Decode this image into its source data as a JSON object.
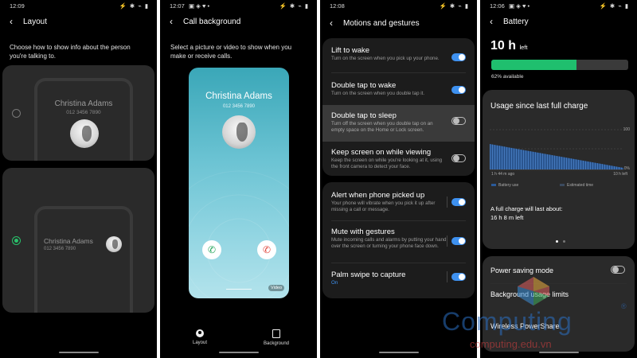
{
  "screen_layout": {
    "status_time": "12:09",
    "status_icons": "⚡ ✱ ⌁ ▮",
    "back": "‹",
    "title": "Layout",
    "description": "Choose how to show info about the person you're talking to.",
    "option1": {
      "name": "Christina Adams",
      "number": "012 3456 7890",
      "selected": false
    },
    "option2": {
      "name": "Christina Adams",
      "number": "012 3456 7890",
      "selected": true
    }
  },
  "screen_background": {
    "status_time": "12:07",
    "status_extra": "▣ ◈ ♥ •",
    "status_icons": "⚡ ✱ ⌁ ▮",
    "back": "‹",
    "title": "Call background",
    "description": "Select a picture or video to show when you make or receive calls.",
    "preview": {
      "name": "Christina Adams",
      "number": "012 3456 7890",
      "video_badge": "Video"
    },
    "tabs": [
      {
        "label": "Layout",
        "icon": "person-icon"
      },
      {
        "label": "Background",
        "icon": "image-icon"
      }
    ]
  },
  "screen_motions": {
    "status_time": "12:08",
    "status_icons": "⚡ ✱ ⌁ ▮",
    "back": "‹",
    "title": "Motions and gestures",
    "group1": [
      {
        "title": "Lift to wake",
        "subtitle": "Turn on the screen when you pick up your phone.",
        "on": true
      },
      {
        "title": "Double tap to wake",
        "subtitle": "Turn on the screen when you double tap it.",
        "on": true
      },
      {
        "title": "Double tap to sleep",
        "subtitle": "Turn off the screen when you double tap on an empty space on the Home or Lock screen.",
        "on": false
      },
      {
        "title": "Keep screen on while viewing",
        "subtitle": "Keep the screen on while you're looking at it, using the front camera to detect your face.",
        "on": false
      }
    ],
    "group2": [
      {
        "title": "Alert when phone picked up",
        "subtitle": "Your phone will vibrate when you pick it up after missing a call or message.",
        "on": true
      },
      {
        "title": "Mute with gestures",
        "subtitle": "Mute incoming calls and alarms by putting your hand over the screen or turning your phone face down.",
        "on": true
      },
      {
        "title": "Palm swipe to capture",
        "subtitle": "On",
        "on": true
      }
    ]
  },
  "screen_battery": {
    "status_time": "12:06",
    "status_extra": "▣ ◈ ♥ •",
    "status_icons": "⚡ ✱ ⌁ ▮",
    "back": "‹",
    "title": "Battery",
    "time_left_value": "10 h",
    "time_left_label": "left",
    "percent_available": "62% available",
    "battery_fraction": 0.62,
    "usage_title": "Usage since last full charge",
    "chart_ymax": "100",
    "chart_ymin": "0%",
    "chart_x_start": "1 h 44 m ago",
    "chart_x_end": "10 h left",
    "legend_used": "Battery use",
    "legend_est": "Estimated time",
    "full_charge_label": "A full charge will last about:",
    "full_charge_value": "16 h 8 m left",
    "items": [
      {
        "label": "Power saving mode",
        "toggle": false
      },
      {
        "label": "Background usage limits"
      },
      {
        "label": "Wireless PowerShare"
      }
    ],
    "watermark_main": "Computing",
    "watermark_sub": "computing.edu.vn",
    "watermark_reg": "®"
  },
  "colors": {
    "accent_blue": "#3e91f0",
    "battery_green": "#1fbf6e",
    "radio_green": "#29c26b",
    "watermark_blue": "#2b6fc4"
  }
}
